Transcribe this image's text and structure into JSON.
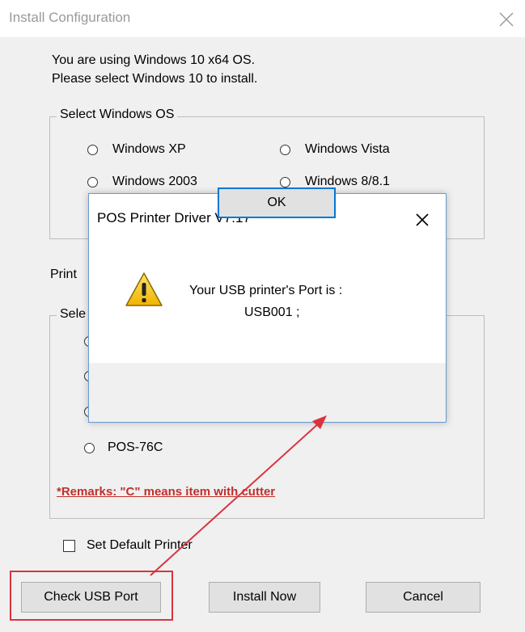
{
  "window": {
    "title": "Install Configuration",
    "close_glyph": "close-icon"
  },
  "intro": {
    "line1": "You are using Windows 10 x64 OS.",
    "line2": "Please select Windows 10 to install."
  },
  "os_group": {
    "label": "Select Windows OS",
    "options": [
      "Windows XP",
      "Windows Vista",
      "Windows 2003",
      "Windows 8/8.1"
    ]
  },
  "printer_section": {
    "label_visible": "Print",
    "group_label_visible": "Sele",
    "visible_option": "POS-76C"
  },
  "remarks": "*Remarks: \"C\" means item with cutter",
  "default_printer": {
    "label": "Set Default Printer",
    "checked": false
  },
  "buttons": {
    "check_usb": "Check USB Port",
    "install_now": "Install Now",
    "cancel": "Cancel"
  },
  "dialog": {
    "title": "POS Printer Driver V7.17",
    "message_line1": "Your USB printer's Port is :",
    "message_line2": "USB001 ;",
    "ok": "OK",
    "icon": "warning-icon"
  },
  "colors": {
    "annotation_red": "#d9333f",
    "remark_red": "#c0302b",
    "dialog_border": "#6b9bd0",
    "focus_blue": "#0078d7"
  }
}
